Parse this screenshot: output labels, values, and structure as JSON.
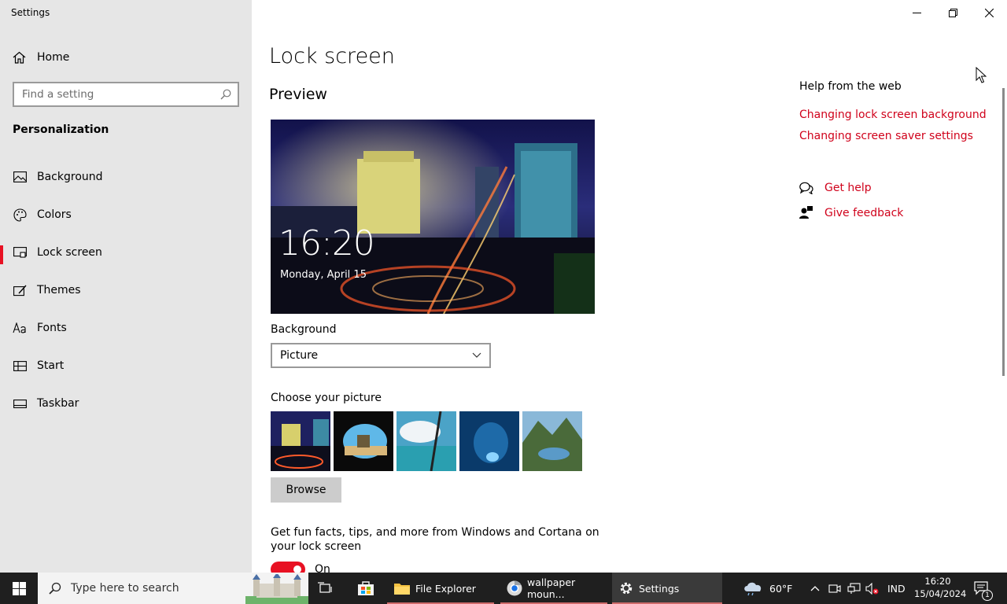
{
  "window": {
    "app_title": "Settings",
    "controls": [
      "minimize-icon",
      "restore-icon",
      "close-icon"
    ]
  },
  "sidebar": {
    "home_label": "Home",
    "search_placeholder": "Find a setting",
    "section_title": "Personalization",
    "items": [
      {
        "label": "Background",
        "icon": "picture-icon",
        "active": false
      },
      {
        "label": "Colors",
        "icon": "palette-icon",
        "active": false
      },
      {
        "label": "Lock screen",
        "icon": "lock-screen-icon",
        "active": true
      },
      {
        "label": "Themes",
        "icon": "themes-icon",
        "active": false
      },
      {
        "label": "Fonts",
        "icon": "fonts-icon",
        "active": false
      },
      {
        "label": "Start",
        "icon": "start-icon",
        "active": false
      },
      {
        "label": "Taskbar",
        "icon": "taskbar-icon",
        "active": false
      }
    ]
  },
  "main": {
    "page_title": "Lock screen",
    "preview_title": "Preview",
    "preview_time": "16:20",
    "preview_date": "Monday, April 15",
    "background_label": "Background",
    "background_value": "Picture",
    "choose_picture_label": "Choose your picture",
    "browse_label": "Browse",
    "fun_facts_label": "Get fun facts, tips, and more from Windows and Cortana on your lock screen",
    "toggle_label": "On"
  },
  "help": {
    "title": "Help from the web",
    "links": [
      "Changing lock screen background",
      "Changing screen saver settings"
    ],
    "get_help": "Get help",
    "give_feedback": "Give feedback"
  },
  "colors": {
    "accent": "#e81123",
    "link": "#d0021b",
    "sidebar_bg": "#e6e6e6",
    "taskbar_bg": "#1f1f1f"
  },
  "taskbar": {
    "search_placeholder": "Type here to search",
    "apps": [
      {
        "label": "File Explorer",
        "icon": "folder-icon",
        "active": false
      },
      {
        "label": "wallpaper moun...",
        "icon": "chrome-icon",
        "active": false
      },
      {
        "label": "Settings",
        "icon": "gear-icon",
        "active": true
      }
    ],
    "weather": "60°F",
    "language": "IND",
    "time": "16:20",
    "date": "15/04/2024",
    "notification_count": "1"
  }
}
